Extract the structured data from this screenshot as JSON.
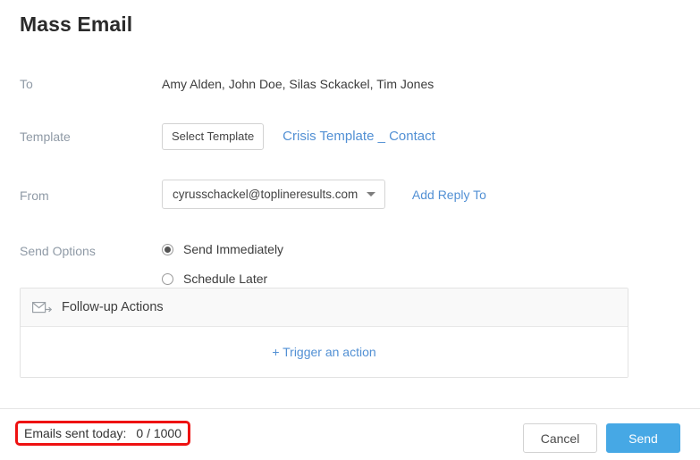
{
  "page": {
    "title": "Mass Email"
  },
  "form": {
    "to": {
      "label": "To",
      "recipients": "Amy Alden, John Doe, Silas Sckackel, Tim Jones"
    },
    "template": {
      "label": "Template",
      "select_button": "Select Template",
      "selected_template": "Crisis Template _ Contact"
    },
    "from": {
      "label": "From",
      "selected_address": "cyrusschackel@toplineresults.com",
      "add_reply_to": "Add Reply To",
      "chevron_icon": "chevron-down-icon"
    },
    "send_options": {
      "label": "Send Options",
      "options": [
        {
          "label": "Send Immediately",
          "selected": true
        },
        {
          "label": "Schedule Later",
          "selected": false
        }
      ]
    }
  },
  "followup_panel": {
    "icon": "envelope-arrow-icon",
    "title": "Follow-up Actions",
    "trigger_link": "+ Trigger an action"
  },
  "footer": {
    "counter_label": "Emails sent today:",
    "counter_value": "0 / 1000",
    "cancel_label": "Cancel",
    "send_label": "Send"
  },
  "colors": {
    "link_blue": "#5290d4",
    "send_button_blue": "#46a8e5",
    "annotation_red": "#ee1111",
    "label_gray": "#8f9aa6",
    "panel_header_gray": "#f9f9f9"
  }
}
